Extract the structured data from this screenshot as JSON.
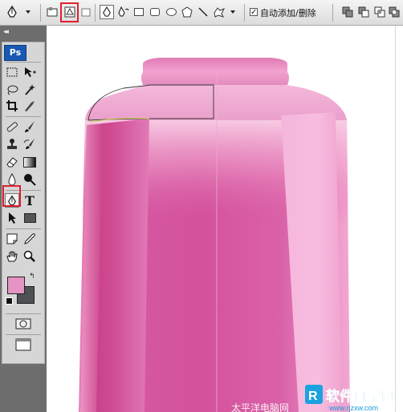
{
  "options_bar": {
    "checkbox_label": "自动添加/删除",
    "auto_add_delete_checked": true,
    "highlighted_option": "paths-mode"
  },
  "tools_panel": {
    "logo_text": "Ps",
    "active_tool": "pen-tool",
    "foreground_color": "#e394c4",
    "background_color": "#4e5154"
  },
  "canvas": {
    "subject": "pink bottle",
    "colors": {
      "bottle_main": "#d5539e",
      "bottle_light": "#f7b3dc",
      "bottle_cap": "#e07ab5",
      "path_stroke": "#333333"
    }
  },
  "watermarks": {
    "site_text": "太平洋电脑网",
    "logo_text": "软件自学网",
    "logo_url": "www.rjzxw.com"
  }
}
